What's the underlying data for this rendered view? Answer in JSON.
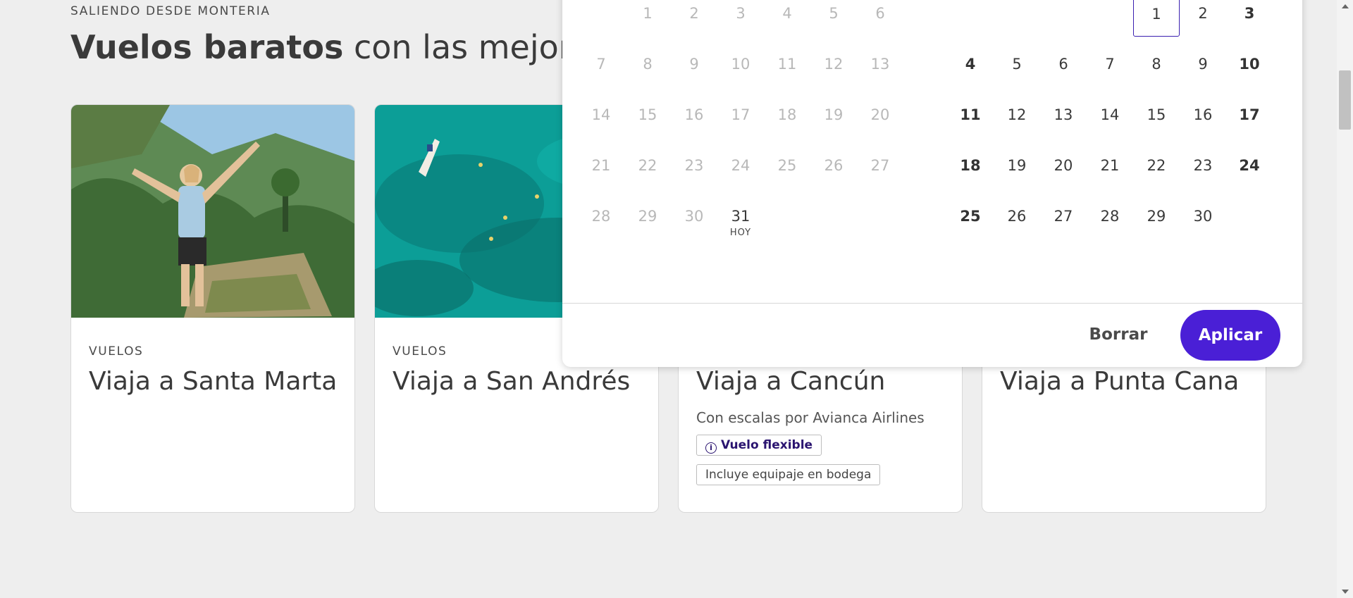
{
  "section": {
    "eyebrow": "SALIENDO DESDE MONTERIA",
    "headline_bold": "Vuelos baratos",
    "headline_rest": " con las mejores"
  },
  "cards": [
    {
      "kicker": "VUELOS",
      "title": "Viaja a Santa Marta"
    },
    {
      "kicker": "VUELOS",
      "title": "Viaja a San Andrés"
    },
    {
      "title": "Viaja a Cancún",
      "subtitle": "Con escalas por Avianca Airlines",
      "tag_flex": "Vuelo flexible",
      "tag_bag": "Incluye equipaje en bodega"
    },
    {
      "title": "Viaja a Punta Cana"
    }
  ],
  "calendar": {
    "left_month_days": [
      "1",
      "2",
      "3",
      "4",
      "5",
      "6",
      "7",
      "8",
      "9",
      "10",
      "11",
      "12",
      "13",
      "14",
      "15",
      "16",
      "17",
      "18",
      "19",
      "20",
      "21",
      "22",
      "23",
      "24",
      "25",
      "26",
      "27",
      "28",
      "29",
      "30",
      "31"
    ],
    "today_label": "HOY",
    "right_month_days": [
      "1",
      "2",
      "3",
      "4",
      "5",
      "6",
      "7",
      "8",
      "9",
      "10",
      "11",
      "12",
      "13",
      "14",
      "15",
      "16",
      "17",
      "18",
      "19",
      "20",
      "21",
      "22",
      "23",
      "24",
      "25",
      "26",
      "27",
      "28",
      "29",
      "30"
    ],
    "clear_label": "Borrar",
    "apply_label": "Aplicar",
    "accent_color": "#4a1fd6"
  },
  "icons": {
    "info": "info-circle-icon"
  }
}
